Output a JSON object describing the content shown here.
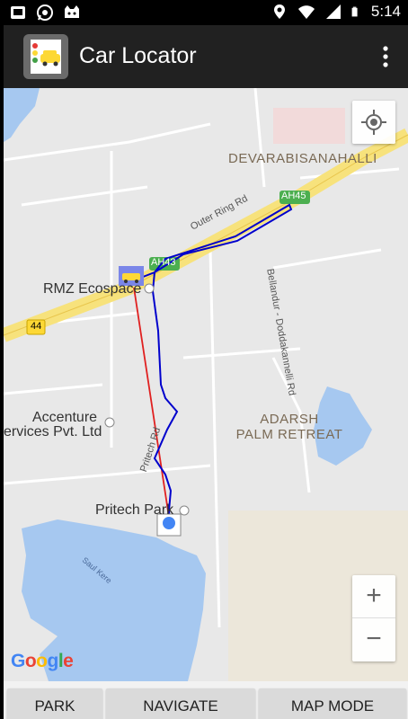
{
  "status_bar": {
    "time": "5:14",
    "left_icons": [
      "notification-icon",
      "whatsapp-icon",
      "cat-icon"
    ],
    "right_icons": [
      "location-icon",
      "wifi-icon",
      "signal-icon",
      "battery-icon"
    ]
  },
  "app": {
    "title": "Car Locator",
    "logo_icon": "car-locator-logo-icon",
    "overflow_icon": "overflow-menu-icon"
  },
  "map": {
    "labels": {
      "devarabisanahalli": "DEVARABISANAHALLI",
      "rmz": "RMZ Ecospace",
      "accenture_line1": "Accenture",
      "accenture_line2": "ervices Pvt. Ltd",
      "adarsh_line1": "ADARSH",
      "adarsh_line2": "PALM RETREAT",
      "pritech_park": "Pritech Park",
      "outer_ring_rd": "Outer Ring Rd",
      "bellandur_rd": "Bellandur - Doddakannelli Rd",
      "pritech_rd": "Pritech Rd",
      "saul_kere": "Saul Kere",
      "ah45": "AH45",
      "ah43": "AH43",
      "route44": "44"
    },
    "route_colors": {
      "walking": "#0000cc",
      "straight": "#e02020",
      "road": "#f7e27c",
      "water": "#a6c8f0",
      "accent": "#4285f4"
    },
    "google_logo": "Google",
    "zoom_in": "+",
    "zoom_out": "−",
    "locate_icon": "my-location-icon"
  },
  "bottom": {
    "park": "PARK",
    "navigate": "NAVIGATE",
    "map_mode": "MAP MODE"
  }
}
